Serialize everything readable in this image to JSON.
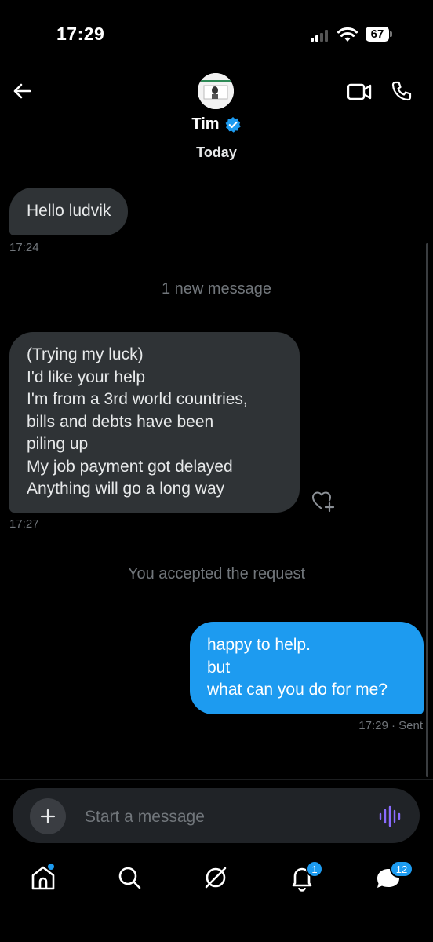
{
  "status_bar": {
    "time": "17:29",
    "battery": "67"
  },
  "header": {
    "name": "Tim",
    "date_label": "Today"
  },
  "messages": {
    "m1": {
      "text": "Hello ludvik",
      "time": "17:24"
    },
    "divider": "1 new message",
    "m2": {
      "lines": [
        "(Trying my luck)",
        "I'd like your help",
        "I'm from a 3rd world countries,",
        "bills and debts have been",
        "piling up",
        "My job payment got delayed",
        "Anything will go a long way"
      ],
      "time": "17:27"
    },
    "system": "You accepted the request",
    "m3": {
      "lines": [
        "happy to help.",
        "but",
        "what can you do for me?"
      ],
      "meta": "17:29 · Sent"
    }
  },
  "composer": {
    "placeholder": "Start a message"
  },
  "tabs": {
    "notifications_badge": "1",
    "messages_badge": "12"
  },
  "colors": {
    "accent": "#1d9bf0",
    "bubble_in": "#2f3336",
    "muted": "#71767b",
    "voice": "#8a6bff"
  }
}
